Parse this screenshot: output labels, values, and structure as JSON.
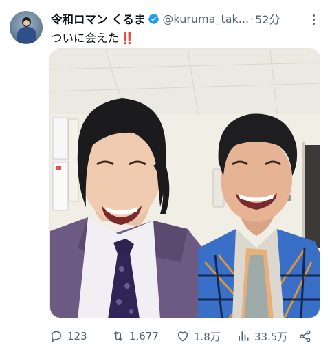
{
  "tweet": {
    "display_name": "令和ロマン くるま",
    "handle": "@kuruma_tak...",
    "separator": "·",
    "time": "52分",
    "text": "ついに会えた",
    "emoji": "‼️",
    "verified_color": "#1d9bf0",
    "avatar_icon": "user-avatar",
    "more_icon": "more-dots-icon"
  },
  "actions": {
    "reply": {
      "icon": "reply-icon",
      "count": "123"
    },
    "retweet": {
      "icon": "retweet-icon",
      "count": "1,677"
    },
    "like": {
      "icon": "heart-icon",
      "count": "1.8万"
    },
    "views": {
      "icon": "views-chart-icon",
      "count": "33.5万"
    },
    "share": {
      "icon": "share-icon"
    }
  },
  "colors": {
    "text_primary": "#0f1419",
    "text_secondary": "#536471",
    "accent": "#1d9bf0"
  }
}
